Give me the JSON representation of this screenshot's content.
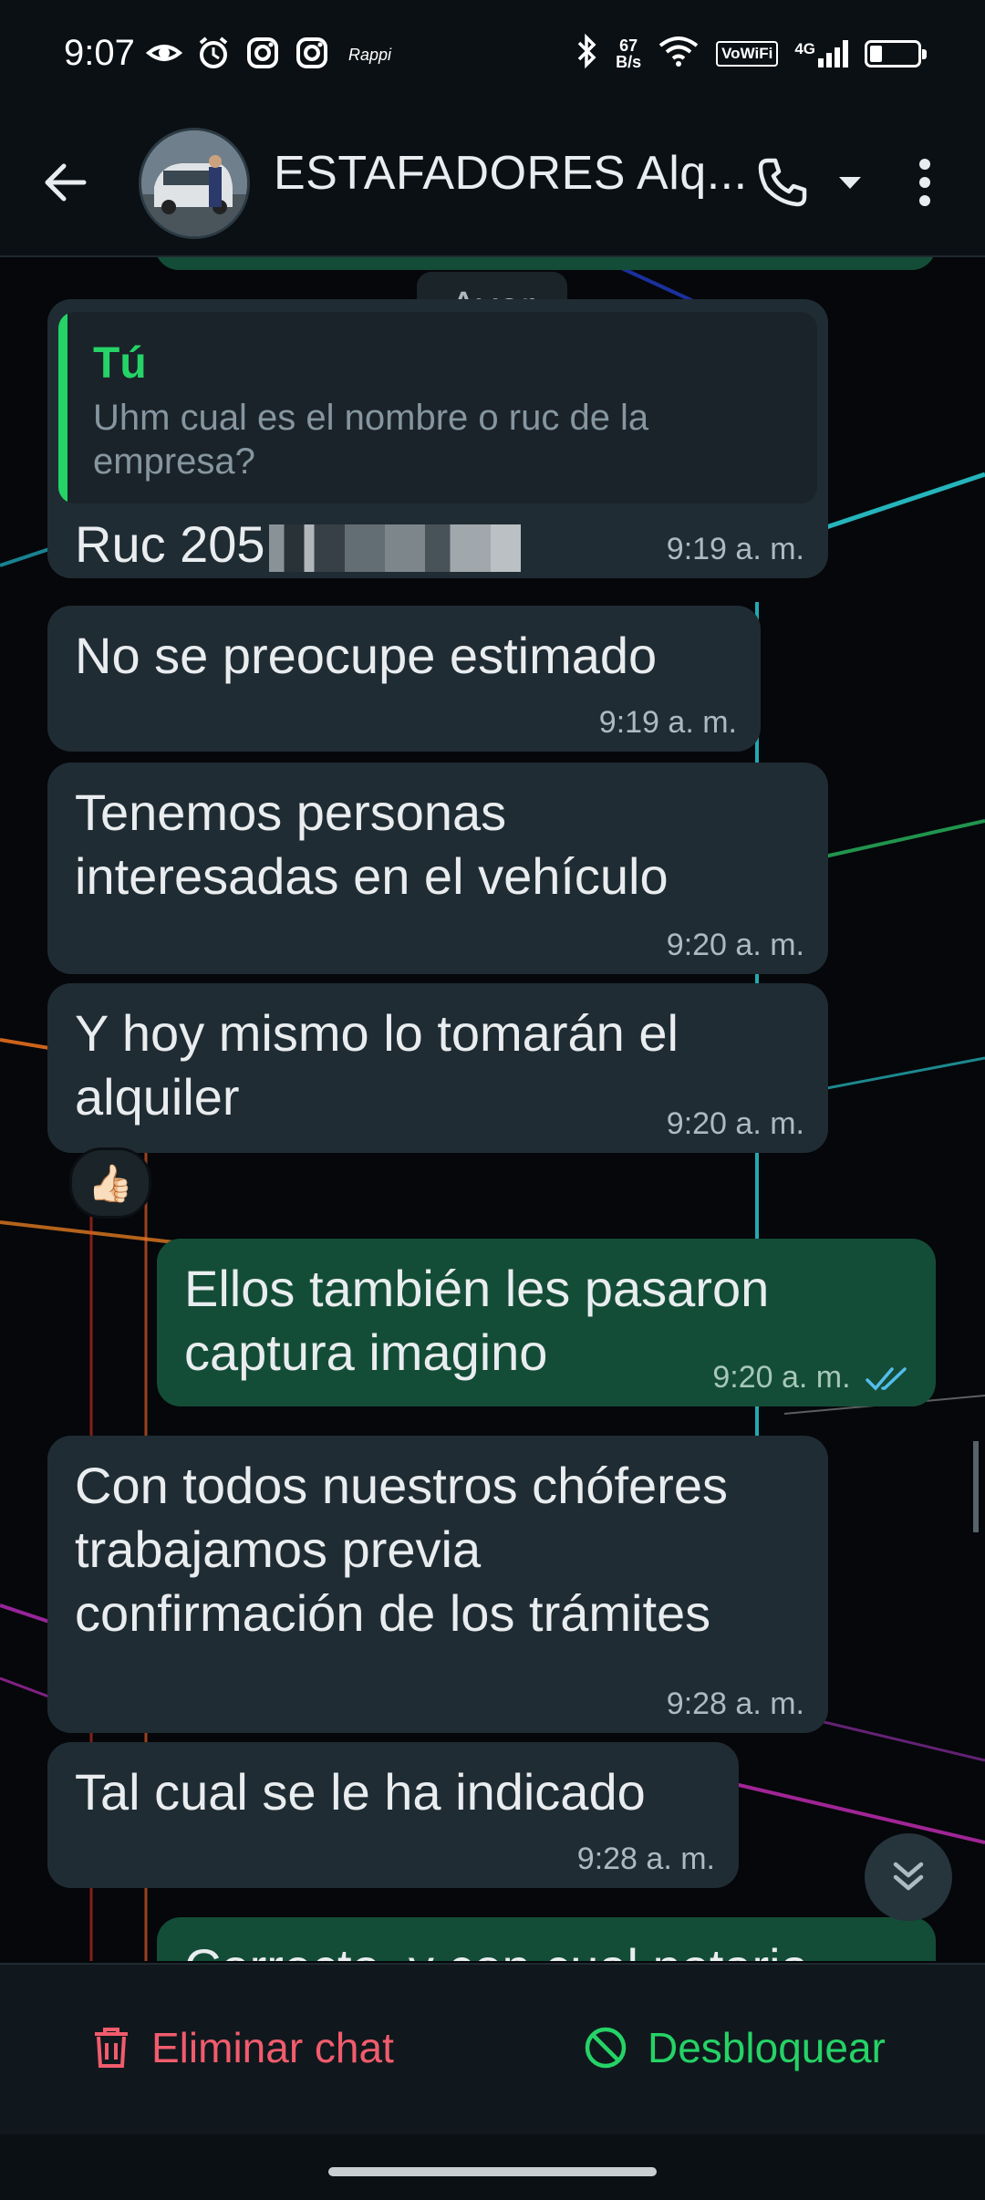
{
  "status_bar": {
    "time": "9:07",
    "left_icons": [
      "eye-icon",
      "alarm-icon",
      "instagram-icon",
      "instagram-icon",
      "rappi-icon"
    ],
    "rappi_label": "Rappi",
    "net_speed_value": "67",
    "net_speed_unit": "B/s",
    "vowifi": "VoWiFi",
    "network": "4G",
    "battery_level": 0.25
  },
  "header": {
    "title": "ESTAFADORES Alq...",
    "back_icon": "arrow-left-icon",
    "call_icon": "phone-icon",
    "menu_icon": "more-vertical-icon"
  },
  "chat": {
    "date_divider": "Ayer",
    "messages": [
      {
        "direction": "in",
        "quote_author": "Tú",
        "quote_text": "Uhm cual es el nombre o ruc de la empresa?",
        "text": "Ruc 205",
        "time": "9:19 a. m."
      },
      {
        "direction": "in",
        "text": "No se preocupe estimado",
        "time": "9:19 a. m."
      },
      {
        "direction": "in",
        "text": "Tenemos personas interesadas en el vehículo",
        "time": "9:20 a. m."
      },
      {
        "direction": "in",
        "text": "Y hoy mismo lo tomarán el alquiler",
        "time": "9:20 a. m.",
        "reaction": "👍🏻"
      },
      {
        "direction": "out",
        "text": "Ellos también les pasaron captura imagino",
        "time": "9:20 a. m.",
        "status": "read"
      },
      {
        "direction": "in",
        "text": "Con todos nuestros chóferes trabajamos previa confirmación de los trámites",
        "time": "9:28 a. m."
      },
      {
        "direction": "in",
        "text": "Tal cual se le ha indicado",
        "time": "9:28 a. m."
      },
      {
        "direction": "out",
        "text": "Correcto, y con cual notaria"
      }
    ]
  },
  "actions": {
    "delete_label": "Eliminar chat",
    "unblock_label": "Desbloquear"
  },
  "colors": {
    "incoming_bubble": "#202c33",
    "outgoing_bubble": "#144d37",
    "accent_green": "#25d366",
    "danger_red": "#f15c6d"
  }
}
